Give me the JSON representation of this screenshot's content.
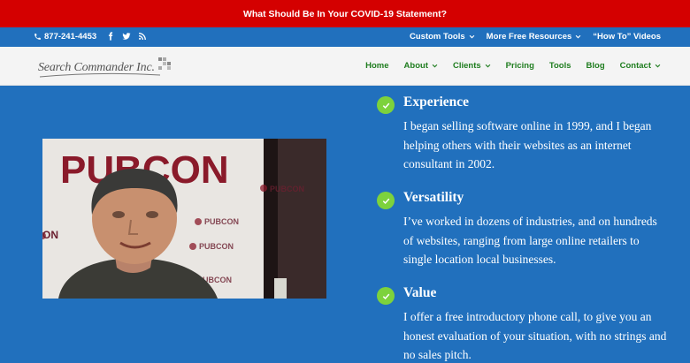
{
  "alert": {
    "text": "What Should Be In Your COVID-19 Statement?"
  },
  "top_bar": {
    "phone": "877-241-4453",
    "social_icons": [
      "facebook-icon",
      "twitter-icon",
      "rss-icon"
    ],
    "links": [
      {
        "label": "Custom Tools",
        "has_dropdown": true
      },
      {
        "label": "More Free Resources",
        "has_dropdown": true
      },
      {
        "label": "“How To” Videos",
        "has_dropdown": false
      }
    ]
  },
  "logo": {
    "text": "Search Commander Inc."
  },
  "nav": {
    "items": [
      {
        "label": "Home",
        "has_dropdown": false
      },
      {
        "label": "About",
        "has_dropdown": true
      },
      {
        "label": "Clients",
        "has_dropdown": true
      },
      {
        "label": "Pricing",
        "has_dropdown": false
      },
      {
        "label": "Tools",
        "has_dropdown": false
      },
      {
        "label": "Blog",
        "has_dropdown": false
      },
      {
        "label": "Contact",
        "has_dropdown": true
      }
    ]
  },
  "video": {
    "banner_text": "PUBCON",
    "banner_logo_text": "PUBCON"
  },
  "features": [
    {
      "title": "Experience",
      "body": "I began selling software online in 1999, and I began helping others with their websites as an internet consultant in 2002."
    },
    {
      "title": "Versatility",
      "body": "I’ve worked in dozens of industries, and on hundreds of websites, ranging from large online retailers to single location local businesses."
    },
    {
      "title": "Value",
      "body": "I offer a free introductory phone call, to give you an honest evaluation of your situation, with no strings and no sales pitch."
    }
  ],
  "colors": {
    "alert_bg": "#d40000",
    "primary_blue": "#2170bd",
    "nav_green": "#1f7d1f",
    "check_green": "#7dd23c",
    "banner_red": "#8a1a2a"
  }
}
